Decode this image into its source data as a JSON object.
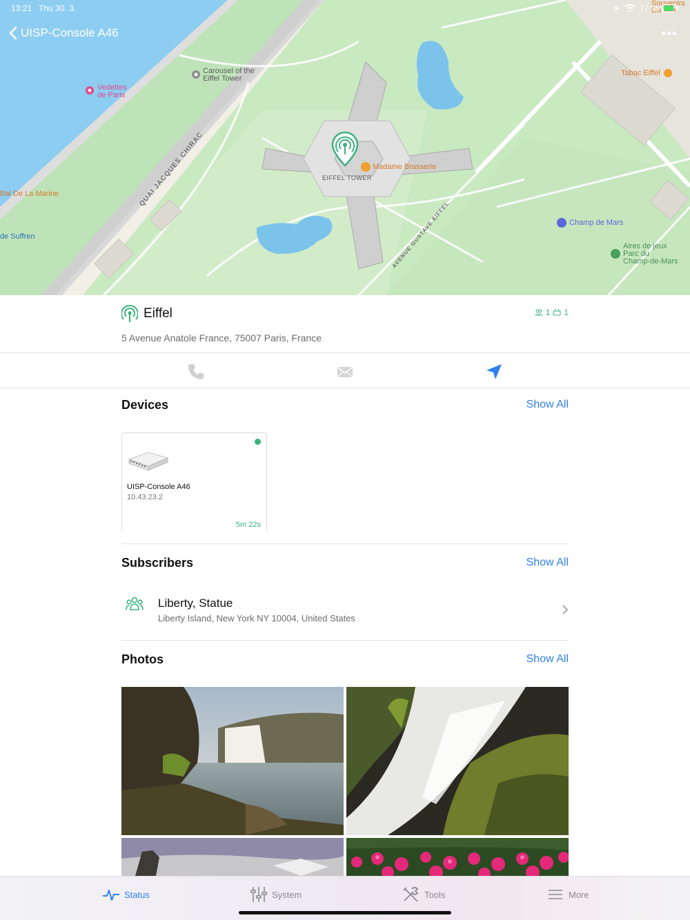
{
  "status_bar": {
    "time": "13:21",
    "date": "Thu 30. 3.",
    "battery": "77 %"
  },
  "nav": {
    "back_label": "UISP-Console A46",
    "more_label": "•••"
  },
  "map": {
    "labels": {
      "vedettes": "Vedettes\nde Paris",
      "carousel": "Carousel of the\nEiffel Tower",
      "tabac": "Tabac Eiffel",
      "souvenirs": "Souvenirs\nDu Tour",
      "madame": "Madame Brasserie",
      "eiffel_tower": "EIFFEL TOWER",
      "bal_marine": "Bal De La Marine",
      "de_suffren": "de Suffren",
      "champ_mars": "Champ de Mars",
      "aires_jeux": "Aires de jeux\nParc du\nChamp-de-Mars",
      "quai": "QUAI JACQUES CHIRAC",
      "avenue": "AVENUE GUSTAVE EIFFEL"
    }
  },
  "site": {
    "name": "Eiffel",
    "address": "5 Avenue Anatole France, 75007 Paris, France",
    "subscriber_count": "1",
    "device_count": "1",
    "accent_color": "#3bb27f"
  },
  "actions": {
    "phone_icon": "phone-icon",
    "mail_icon": "mail-icon",
    "navigate_icon": "location-arrow-icon"
  },
  "devices": {
    "title": "Devices",
    "show_all": "Show All",
    "items": [
      {
        "name": "UISP-Console A46",
        "ip": "10.43.23.2",
        "uptime": "5m 22s",
        "status": "online"
      }
    ]
  },
  "subscribers": {
    "title": "Subscribers",
    "show_all": "Show All",
    "items": [
      {
        "name": "Liberty, Statue",
        "address": "Liberty Island, New York NY 10004, United States"
      }
    ]
  },
  "photos": {
    "title": "Photos",
    "show_all": "Show All"
  },
  "tabbar": {
    "tabs": [
      {
        "label": "Status",
        "icon": "pulse-icon",
        "active": true
      },
      {
        "label": "System",
        "icon": "sliders-icon",
        "active": false
      },
      {
        "label": "Tools",
        "icon": "tools-icon",
        "active": false
      },
      {
        "label": "More",
        "icon": "menu-icon",
        "active": false
      }
    ]
  },
  "colors": {
    "link": "#2f80ed",
    "online": "#3bb27f"
  }
}
